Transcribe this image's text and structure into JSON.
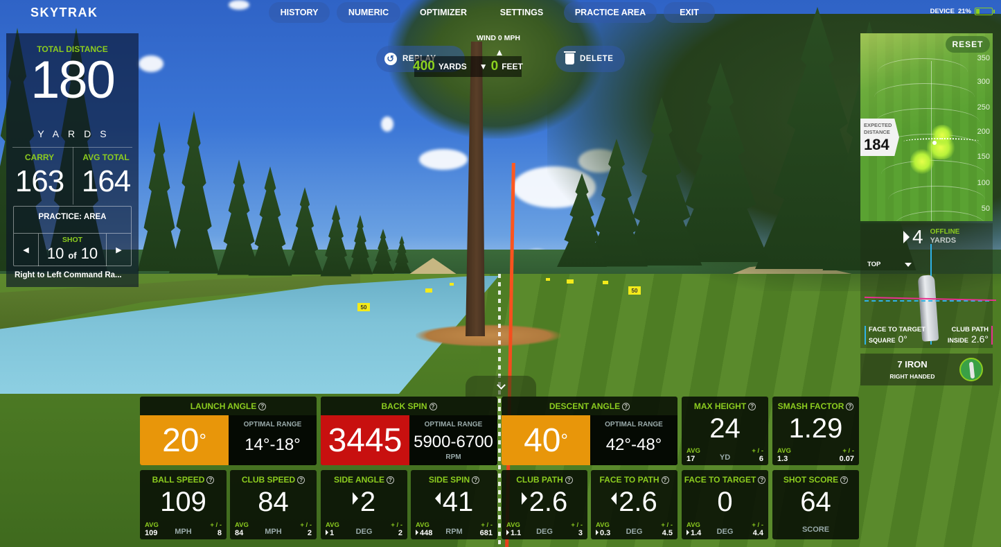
{
  "app": {
    "logo": "SKYTRAK"
  },
  "nav": {
    "items": [
      {
        "label": "HISTORY"
      },
      {
        "label": "NUMERIC"
      },
      {
        "label": "OPTIMIZER"
      },
      {
        "label": "SETTINGS"
      },
      {
        "label": "PRACTICE AREA"
      },
      {
        "label": "EXIT"
      }
    ],
    "device_label": "DEVICE",
    "battery_percent": "21%",
    "battery_level": 0.21,
    "battery_color": "#8cd11f"
  },
  "distance_panel": {
    "total_label": "TOTAL DISTANCE",
    "total_value": "180",
    "total_unit": "YARDS",
    "carry_label": "CARRY",
    "carry_value": "163",
    "avg_total_label": "AVG TOTAL",
    "avg_total_value": "164",
    "practice_title": "PRACTICE: AREA",
    "shot_label": "SHOT",
    "shot_current": "10",
    "shot_of": "of",
    "shot_total": "10",
    "drill_name": "Right to Left Command Ra..."
  },
  "center_controls": {
    "wind": "WIND 0 MPH",
    "replay_label": "REPLAY",
    "delete_label": "DELETE",
    "target_distance": "400",
    "target_distance_unit": "YARDS",
    "elevation_value": "0",
    "elevation_unit": "FEET"
  },
  "scene": {
    "yardage_flag": "50"
  },
  "dispersion": {
    "reset_label": "RESET",
    "scale": [
      "350",
      "300",
      "250",
      "200",
      "150",
      "100",
      "50"
    ],
    "expected_label_1": "EXPECTED",
    "expected_label_2": "DISTANCE",
    "expected_value": "184"
  },
  "club_panel": {
    "offline_value": "4",
    "offline_label": "OFFLINE",
    "offline_unit": "YARDS",
    "view_label": "TOP",
    "face_to_target_label": "FACE TO TARGET",
    "face_to_target_desc": "SQUARE",
    "face_to_target_value": "0°",
    "club_path_label": "CLUB PATH",
    "club_path_desc": "INSIDE",
    "club_path_value": "2.6°",
    "face_color": "#2fb3e8",
    "path_color": "#e8308f",
    "club_name": "7 IRON",
    "handedness": "RIGHT HANDED"
  },
  "metrics": {
    "launch_angle": {
      "label": "LAUNCH ANGLE",
      "value": "20",
      "deg": "°",
      "optimal_label": "OPTIMAL RANGE",
      "optimal_value": "14°-18°",
      "status_color": "#e8960a"
    },
    "back_spin": {
      "label": "BACK SPIN",
      "value": "3445",
      "optimal_label": "OPTIMAL RANGE",
      "optimal_value": "5900-6700",
      "optimal_unit": "RPM",
      "status_color": "#c8100f"
    },
    "descent_angle": {
      "label": "DESCENT ANGLE",
      "value": "40",
      "deg": "°",
      "optimal_label": "OPTIMAL RANGE",
      "optimal_value": "42°-48°",
      "status_color": "#e8960a"
    },
    "max_height": {
      "label": "MAX HEIGHT",
      "value": "24",
      "unit": "YD",
      "avg": "17",
      "pm": "6"
    },
    "smash_factor": {
      "label": "SMASH FACTOR",
      "value": "1.29",
      "unit": "",
      "avg": "1.3",
      "pm": "0.07"
    },
    "ball_speed": {
      "label": "BALL SPEED",
      "value": "109",
      "unit": "MPH",
      "avg": "109",
      "pm": "8"
    },
    "club_speed": {
      "label": "CLUB SPEED",
      "value": "84",
      "unit": "MPH",
      "avg": "84",
      "pm": "2"
    },
    "side_angle": {
      "label": "SIDE ANGLE",
      "value": "2",
      "direction": "right",
      "unit": "DEG",
      "avg": "1",
      "avg_direction": "right",
      "pm": "2"
    },
    "side_spin": {
      "label": "SIDE SPIN",
      "value": "41",
      "direction": "left",
      "unit": "RPM",
      "avg": "448",
      "avg_direction": "right",
      "pm": "681"
    },
    "club_path": {
      "label": "CLUB PATH",
      "value": "2.6",
      "direction": "right",
      "unit": "DEG",
      "avg": "1.1",
      "avg_direction": "right",
      "pm": "3"
    },
    "face_to_path": {
      "label": "FACE TO PATH",
      "value": "2.6",
      "direction": "left",
      "unit": "DEG",
      "avg": "0.3",
      "avg_direction": "right",
      "pm": "4.5"
    },
    "face_to_target": {
      "label": "FACE TO TARGET",
      "value": "0",
      "unit": "DEG",
      "avg": "1.4",
      "avg_direction": "right",
      "pm": "4.4"
    },
    "shot_score": {
      "label": "SHOT SCORE",
      "value": "64",
      "unit": "SCORE"
    },
    "avg_label": "AVG",
    "pm_label": "+ / -",
    "help_glyph": "?"
  }
}
